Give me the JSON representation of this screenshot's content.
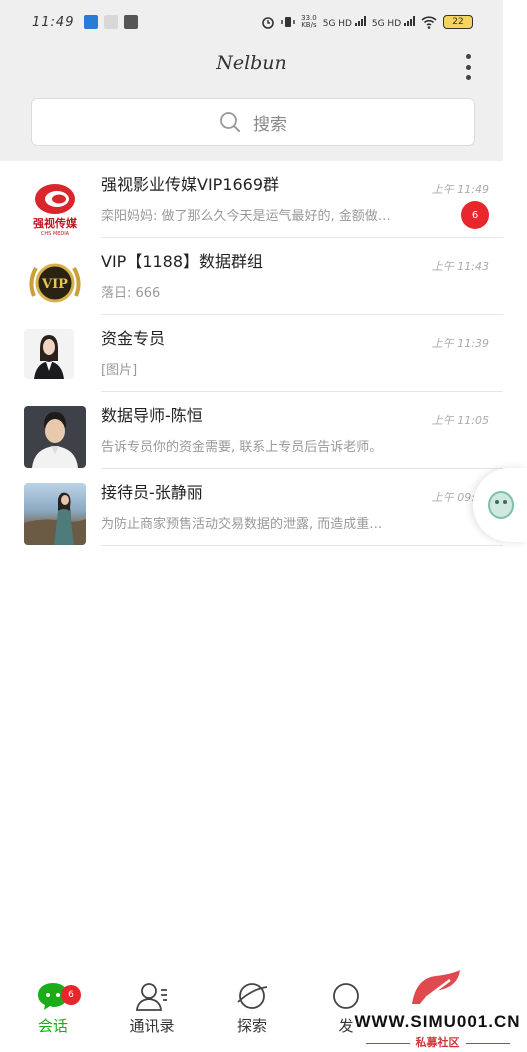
{
  "status_bar": {
    "time": "11:49",
    "net_speed": "33.0",
    "net_unit": "KB/s",
    "signal_1": "5G HD",
    "signal_2": "5G HD",
    "battery": "22"
  },
  "header": {
    "title": "Nelbun"
  },
  "search": {
    "placeholder": "搜索"
  },
  "chats": [
    {
      "name": "强视影业传媒VIP1669群",
      "preview": "栾阳妈妈: 做了那么久今天是运气最好的, 金额做…",
      "time": "上午 11:49",
      "unread": "6",
      "avatar_text": "强视传媒",
      "avatar_sub": "CHS MEDIA"
    },
    {
      "name": "VIP【1188】数据群组",
      "preview": "落日: 666",
      "time": "上午 11:43",
      "avatar_text": "VIP"
    },
    {
      "name": "资金专员",
      "preview": "[图片]",
      "time": "上午 11:39"
    },
    {
      "name": "数据导师-陈恒",
      "preview": "告诉专员你的资金需要, 联系上专员后告诉老师。",
      "time": "上午 11:05"
    },
    {
      "name": "接待员-张静丽",
      "preview": "为防止商家预售活动交易数据的泄露, 而造成重…",
      "time": "上午 09:30"
    }
  ],
  "tabbar": {
    "tabs": [
      {
        "label": "会话",
        "badge": "6"
      },
      {
        "label": "通讯录"
      },
      {
        "label": "探索"
      },
      {
        "label": "发"
      }
    ]
  },
  "watermark": {
    "text": "WWW.SIMU001.CN",
    "sub": "私募社区"
  },
  "colors": {
    "accent": "#1aad19",
    "badge": "#e8262b",
    "header_bg": "#efefef"
  }
}
